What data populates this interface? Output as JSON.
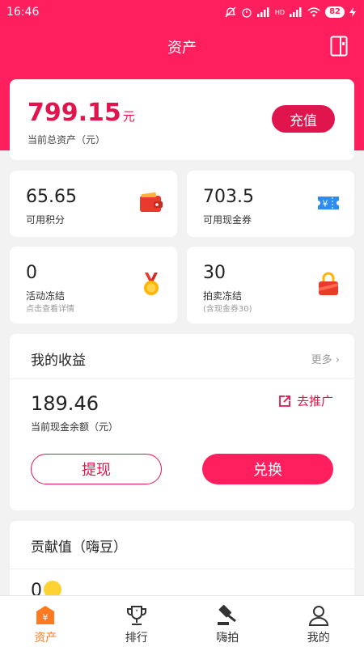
{
  "status_bar": {
    "time": "16:46",
    "battery": "82",
    "signal_tag": "HD"
  },
  "header": {
    "title": "资产"
  },
  "total": {
    "amount": "799.15",
    "unit": "元",
    "label": "当前总资产（元）",
    "recharge_label": "充值"
  },
  "stats": [
    {
      "value": "65.65",
      "label": "可用积分",
      "sub": "",
      "icon": "wallet-icon"
    },
    {
      "value": "703.5",
      "label": "可用现金券",
      "sub": "",
      "icon": "coupon-icon"
    },
    {
      "value": "0",
      "label": "活动冻结",
      "sub": "点击查看详情",
      "icon": "medal-icon"
    },
    {
      "value": "30",
      "label": "拍卖冻结",
      "sub": "(含现金券30)",
      "icon": "lock-icon"
    }
  ],
  "earnings": {
    "title": "我的收益",
    "more": "更多 ›",
    "amount": "189.46",
    "label": "当前现金余额（元）",
    "promote": "去推广",
    "withdraw": "提现",
    "exchange": "兑换"
  },
  "contribution": {
    "title": "贡献值（嗨豆）",
    "value": "0"
  },
  "tabs": [
    {
      "label": "资产",
      "icon": "assets-icon",
      "active": true
    },
    {
      "label": "排行",
      "icon": "trophy-icon",
      "active": false
    },
    {
      "label": "嗨拍",
      "icon": "gavel-icon",
      "active": false
    },
    {
      "label": "我的",
      "icon": "user-icon",
      "active": false
    }
  ],
  "colors": {
    "brand": "#ff1f5e",
    "accent": "#e0154d",
    "tab_active": "#ff7a1f"
  }
}
